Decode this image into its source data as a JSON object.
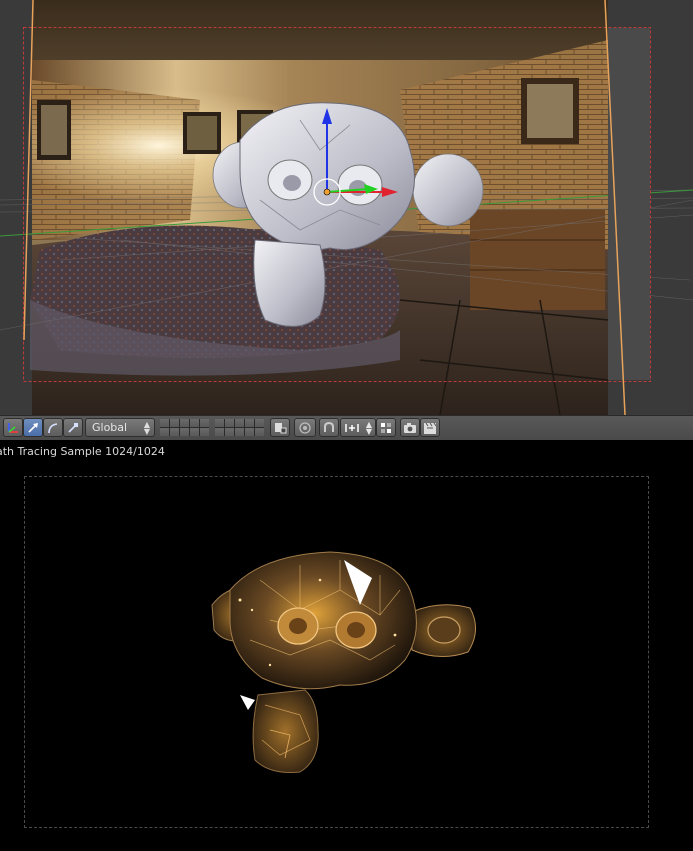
{
  "toolbar": {
    "orientation": "Global",
    "items": [
      {
        "icon": "manipulator-icon"
      },
      {
        "icon": "translate-icon",
        "active": true
      },
      {
        "icon": "rotate-icon"
      },
      {
        "icon": "scale-icon"
      },
      {
        "icon": "layers-icon"
      },
      {
        "icon": "lock-camera-icon"
      },
      {
        "icon": "proportional-edit-icon"
      },
      {
        "icon": "snap-icon"
      },
      {
        "icon": "snap-element-icon"
      },
      {
        "icon": "snap-target-icon"
      },
      {
        "icon": "render-image-icon"
      },
      {
        "icon": "render-animation-icon"
      }
    ]
  },
  "render": {
    "status": "ath Tracing Sample 1024/1024"
  },
  "colors": {
    "header": "#4e4e4e",
    "active_button": "#5680c2",
    "camera_frame": "#e8a35a",
    "axis_x": "#e0232e",
    "axis_y": "#22d022",
    "axis_z": "#1f34e6"
  }
}
